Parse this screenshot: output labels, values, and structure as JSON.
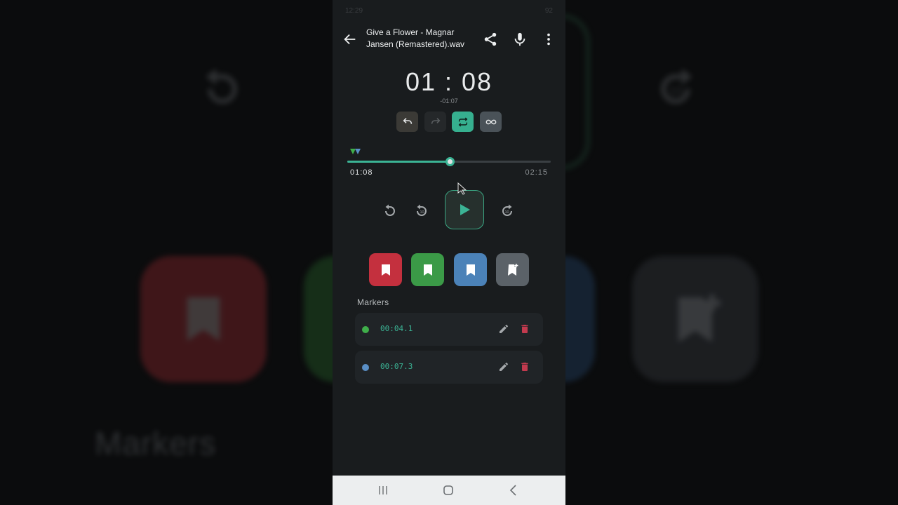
{
  "background": {
    "markers_text": "Markers"
  },
  "status_bar": {
    "time": "12:29",
    "battery": "92"
  },
  "header": {
    "title": "Give a Flower - Magnar Jansen (Remastered).wav",
    "back_icon": "arrow-left-icon",
    "share_icon": "share-icon",
    "mic_icon": "microphone-icon",
    "more_icon": "more-vertical-icon"
  },
  "timer": {
    "elapsed": "01 : 08",
    "remaining": "-01:07"
  },
  "controls": [
    {
      "name": "undo",
      "icon": "undo-icon",
      "color": "#3b3a36"
    },
    {
      "name": "redo",
      "icon": "redo-icon",
      "color": "#25282a"
    },
    {
      "name": "repeat",
      "icon": "repeat-icon",
      "color": "#36b08f"
    },
    {
      "name": "loop",
      "icon": "infinity-icon",
      "color": "#4a5258"
    }
  ],
  "seek": {
    "current": "01:08",
    "total": "02:15",
    "progress": 0.504
  },
  "transport": {
    "restart_icon": "restart-icon",
    "rewind_icon": "rewind-10-icon",
    "play_icon": "play-icon",
    "forward_icon": "forward-10-icon"
  },
  "marker_buttons": [
    {
      "color": "#c4303e",
      "icon": "bookmark-icon"
    },
    {
      "color": "#3b9a47",
      "icon": "bookmark-icon"
    },
    {
      "color": "#4b82b8",
      "icon": "bookmark-icon"
    },
    {
      "color": "#5b6268",
      "icon": "bookmark-add-icon"
    }
  ],
  "markers": {
    "label": "Markers",
    "items": [
      {
        "time": "00:04.1",
        "color": "#3fae4a"
      },
      {
        "time": "00:07.3",
        "color": "#5a8fc6"
      }
    ]
  },
  "colors": {
    "accent": "#3bb495",
    "delete": "#c23a4e"
  }
}
